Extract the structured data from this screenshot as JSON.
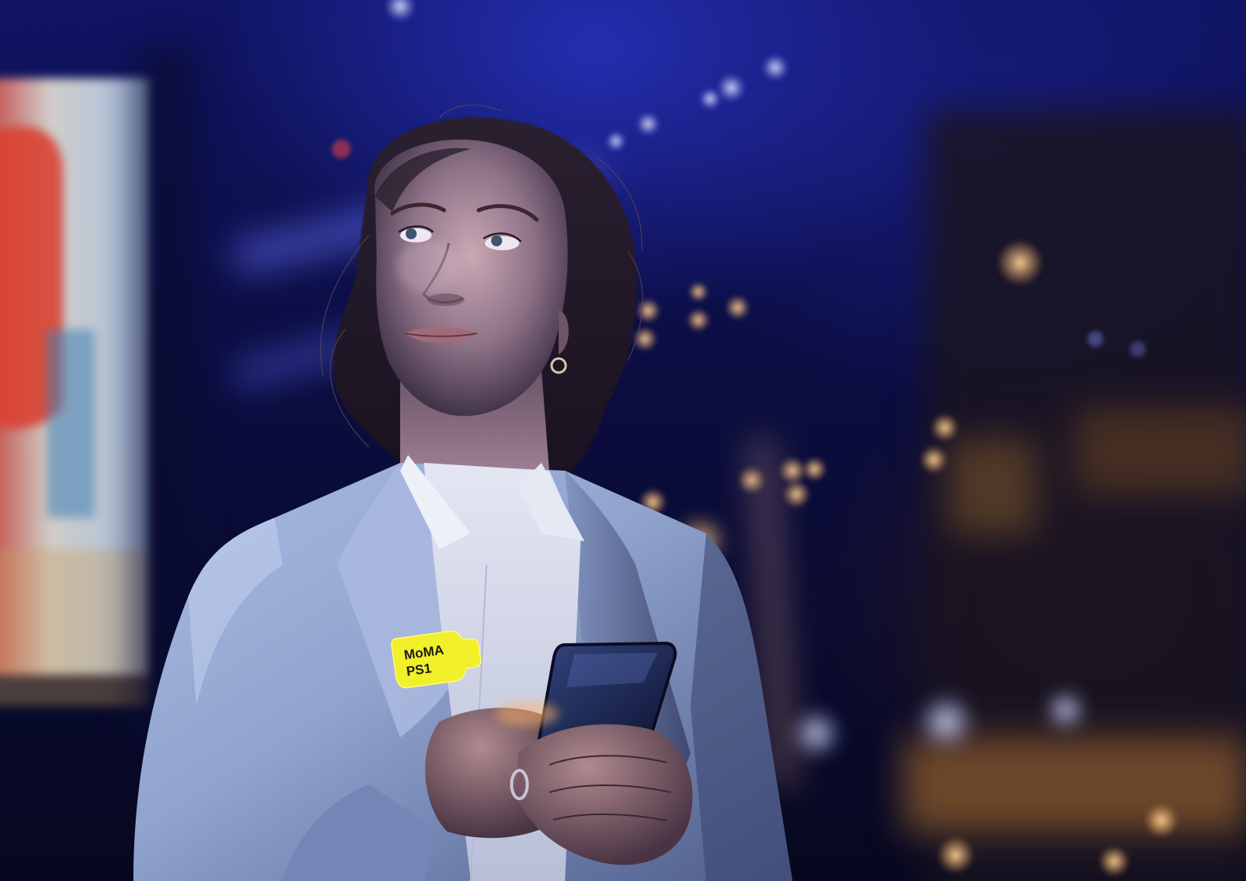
{
  "photo": {
    "subject": "woman-holding-smartphone-night-city"
  },
  "badge": {
    "line1": "MoMA",
    "line2": "PS1",
    "color": "#f2ef2b",
    "text_color": "#1c1c1c"
  },
  "colors": {
    "night_blue": "#101463",
    "jacket": "#9fb3d9",
    "warm_light": "#ffc27a"
  }
}
